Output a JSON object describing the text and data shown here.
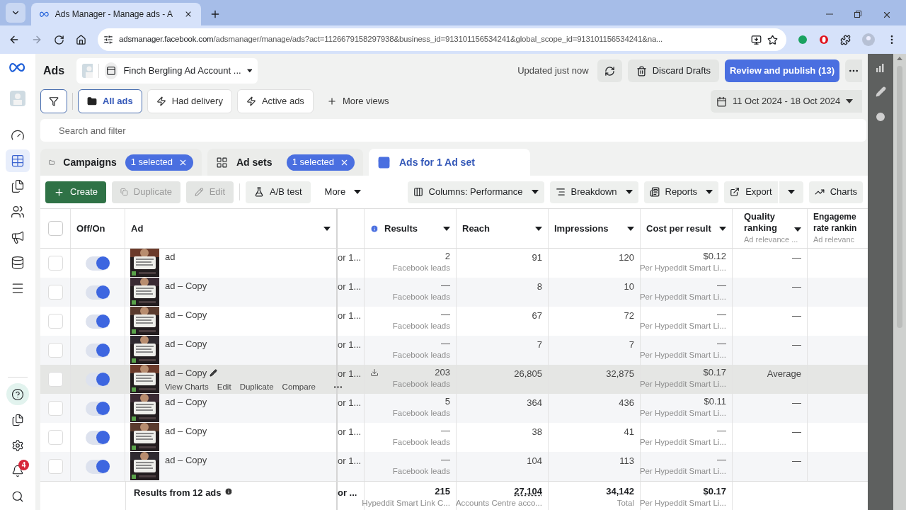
{
  "browser": {
    "tab_title": "Ads Manager - Manage ads - A",
    "url_host": "adsmanager.facebook.com",
    "url_path": "/adsmanager/manage/ads?act=1126679158297938&business_id=913101156534241&global_scope_id=913101156534241&na..."
  },
  "nav": {
    "items": [
      {
        "kind": "dashboard",
        "selected": false
      },
      {
        "kind": "table",
        "selected": true
      },
      {
        "kind": "pages",
        "selected": false
      },
      {
        "kind": "audiences",
        "selected": false
      },
      {
        "kind": "ads",
        "selected": false
      },
      {
        "kind": "billing",
        "selected": false
      },
      {
        "kind": "menu",
        "selected": false
      }
    ],
    "bottom": [
      {
        "kind": "help"
      },
      {
        "kind": "pages"
      },
      {
        "kind": "settings"
      },
      {
        "kind": "notifications",
        "badge": "4"
      },
      {
        "kind": "search"
      }
    ]
  },
  "header": {
    "title": "Ads",
    "account": "Finch Bergling Ad Account ...",
    "updated": "Updated just now",
    "discard": "Discard Drafts",
    "publish": "Review and publish (13)",
    "date_range": "11 Oct 2024 - 18 Oct 2024"
  },
  "views": [
    {
      "label": "All ads",
      "kind": "folder",
      "selected": true
    },
    {
      "label": "Had delivery",
      "kind": "bolt",
      "selected": false
    },
    {
      "label": "Active ads",
      "kind": "bolt",
      "selected": false
    }
  ],
  "more_views": "More views",
  "search": {
    "placeholder": "Search and filter"
  },
  "levels": [
    {
      "label": "Campaigns",
      "kind": "campaigns",
      "badge": "1 selected",
      "selected": false
    },
    {
      "label": "Ad sets",
      "kind": "adsets",
      "badge": "1 selected",
      "selected": false
    },
    {
      "label": "Ads for 1 Ad set",
      "kind": "ads",
      "selected": true
    }
  ],
  "toolbar": {
    "create": "Create",
    "duplicate": {
      "label": "Duplicate",
      "disabled": true
    },
    "edit": {
      "label": "Edit",
      "disabled": true
    },
    "ab_test": "A/B test",
    "more": "More",
    "columns": "Columns: Performance",
    "breakdown": "Breakdown",
    "reports": "Reports",
    "export": "Export",
    "charts": "Charts"
  },
  "table": {
    "select_all_checked": false,
    "columns": [
      "Off/On",
      "Ad",
      "Results",
      "Reach",
      "Impressions",
      "Cost per result"
    ],
    "quality_header": "Quality ranking",
    "quality_sub": "Ad relevance ...",
    "engagement_header_1": "Engageme",
    "engagement_header_2": "rate rankin",
    "engagement_sub": "Ad relevanc",
    "rows": [
      {
        "name": "ad",
        "on": true,
        "hovered": false,
        "column_3": "or 1...",
        "results": "2",
        "results_sub": "Facebook leads",
        "reach": "91",
        "impressions": "120",
        "cost": "$0.12",
        "cost_sub": "Per Hypeddit Smart Li...",
        "quality": "—"
      },
      {
        "name": "ad – Copy",
        "on": true,
        "hovered": false,
        "column_3": "or 1...",
        "results": "—",
        "results_sub": "Facebook leads",
        "reach": "8",
        "impressions": "10",
        "cost": "—",
        "cost_sub": "Per Hypeddit Smart Li...",
        "quality": "—"
      },
      {
        "name": "ad – Copy",
        "on": true,
        "hovered": false,
        "column_3": "or 1...",
        "results": "—",
        "results_sub": "Facebook leads",
        "reach": "67",
        "impressions": "72",
        "cost": "—",
        "cost_sub": "Per Hypeddit Smart Li...",
        "quality": "—"
      },
      {
        "name": "ad – Copy",
        "on": true,
        "hovered": false,
        "column_3": "or 1...",
        "results": "—",
        "results_sub": "Facebook leads",
        "reach": "7",
        "impressions": "7",
        "cost": "—",
        "cost_sub": "Per Hypeddit Smart Li...",
        "quality": "—"
      },
      {
        "name": "ad – Copy",
        "on": true,
        "hovered": true,
        "column_3": "or 1...",
        "results": "203",
        "results_sub": "Facebook leads",
        "reach": "26,805",
        "impressions": "32,875",
        "cost": "$0.17",
        "cost_sub": "Per Hypeddit Smart Li...",
        "quality": "Average"
      },
      {
        "name": "ad – Copy",
        "on": true,
        "hovered": false,
        "column_3": "or 1...",
        "results": "5",
        "results_sub": "Facebook leads",
        "reach": "364",
        "impressions": "436",
        "cost": "$0.11",
        "cost_sub": "Per Hypeddit Smart Li...",
        "quality": "—"
      },
      {
        "name": "ad – Copy",
        "on": true,
        "hovered": false,
        "column_3": "or 1...",
        "results": "—",
        "results_sub": "Facebook leads",
        "reach": "38",
        "impressions": "41",
        "cost": "—",
        "cost_sub": "Per Hypeddit Smart Li...",
        "quality": "—"
      },
      {
        "name": "ad – Copy",
        "on": true,
        "hovered": false,
        "column_3": "or 1...",
        "results": "—",
        "results_sub": "Facebook leads",
        "reach": "104",
        "impressions": "113",
        "cost": "—",
        "cost_sub": "Per Hypeddit Smart Li...",
        "quality": "—"
      }
    ],
    "row_actions": [
      "View Charts",
      "Edit",
      "Duplicate",
      "Compare"
    ],
    "footer": {
      "label": "Results from 12 ads",
      "column_3": "or ...",
      "results": "215",
      "results_sub": "Hypeddit Smart Link C...",
      "reach": "27,104",
      "reach_sub": "Accounts Centre acco...",
      "impressions": "34,142",
      "impressions_sub": "Total",
      "cost": "$0.17",
      "cost_sub": "Per Hypeddit Smart Li..."
    }
  }
}
